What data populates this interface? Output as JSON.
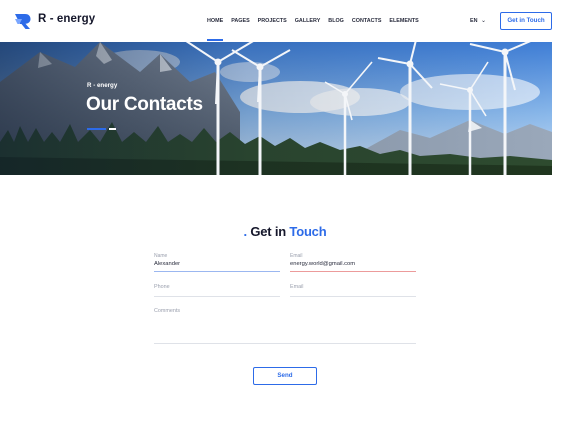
{
  "brand": {
    "name": "R - energy"
  },
  "nav": {
    "items": [
      "HOME",
      "PAGES",
      "PROJECTS",
      "GALLERY",
      "BLOG",
      "CONTACTS",
      "ELEMENTS"
    ],
    "active": "HOME"
  },
  "header": {
    "lang": "EN",
    "cta_label": "Get in Touch"
  },
  "hero": {
    "breadcrumb": "R - energy",
    "title": "Our Contacts"
  },
  "section": {
    "title_prefix": ". ",
    "title_main": "Get in ",
    "title_accent": "Touch"
  },
  "form": {
    "name": {
      "label": "Name",
      "value": "Alexander"
    },
    "email": {
      "label": "Email",
      "value": "energy.world@gmail.com"
    },
    "phone": {
      "placeholder": "Phone"
    },
    "email2": {
      "placeholder": "Email"
    },
    "comments": {
      "placeholder": "Comments"
    },
    "send_label": "Send"
  },
  "colors": {
    "accent": "#2d6be8",
    "error": "#e88a8a",
    "text": "#1a1d2e"
  }
}
